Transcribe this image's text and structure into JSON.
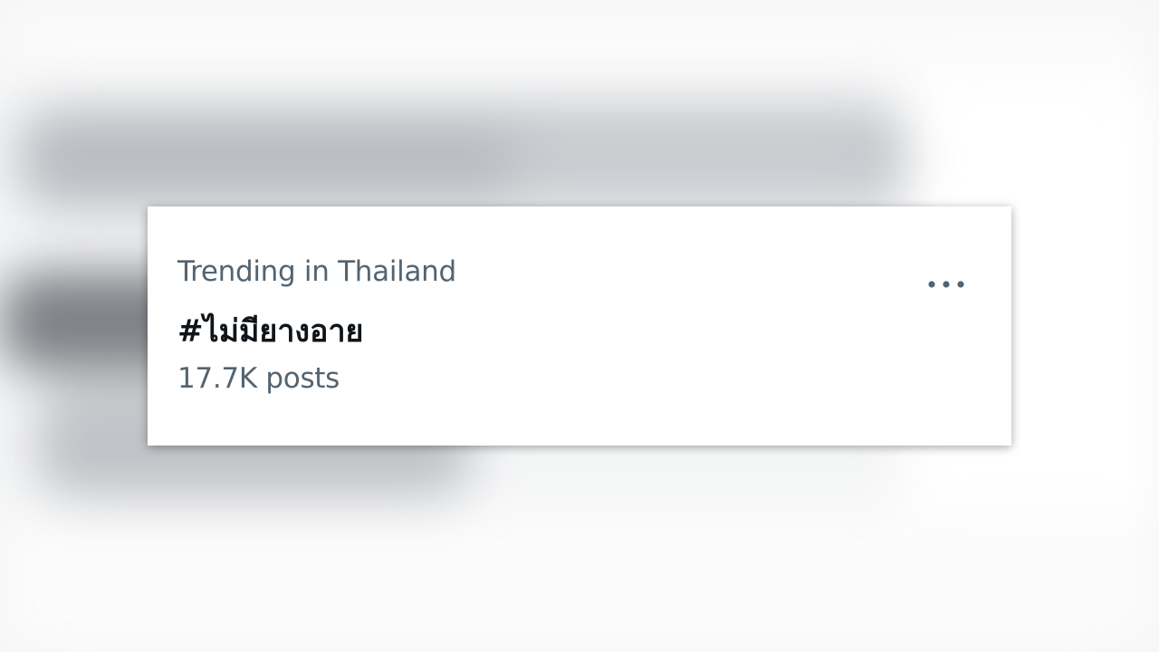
{
  "trend": {
    "context": "Trending in Thailand",
    "topic": "#ไม่มียางอาย",
    "post_count": "17.7K posts"
  },
  "icons": {
    "more": "more-horizontal-icon"
  },
  "colors": {
    "secondary_text": "#536471",
    "primary_text": "#0f1419",
    "card_background": "#ffffff"
  }
}
